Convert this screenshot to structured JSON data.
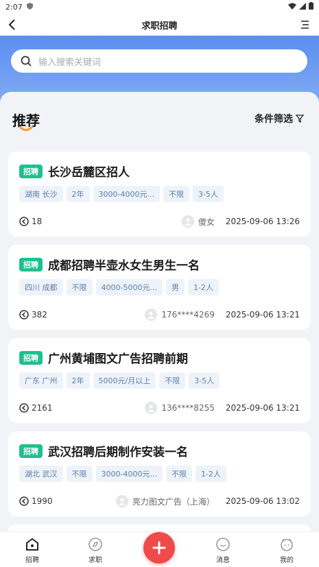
{
  "status_bar": {
    "time": "2:07"
  },
  "nav": {
    "title": "求职招聘"
  },
  "search": {
    "placeholder": "输入搜索关键词"
  },
  "section": {
    "title": "推荐",
    "filter_label": "条件筛选"
  },
  "colors": {
    "accent_blue": "#5b8ef0",
    "badge_green": "#1fbf8f",
    "fab_red": "#f04b4b",
    "smile_orange": "#f59b2b"
  },
  "cards": [
    {
      "badge": "招聘",
      "title": "长沙岳麓区招人",
      "tags": [
        "湖南 长沙",
        "2年",
        "3000-4000元...",
        "不限",
        "3-5人"
      ],
      "views": "18",
      "author": "傻女",
      "date": "2025-09-06 13:26"
    },
    {
      "badge": "招聘",
      "title": "成都招聘半壶水女生男生一名",
      "tags": [
        "四川 成都",
        "不限",
        "4000-5000元...",
        "男",
        "1-2人"
      ],
      "views": "382",
      "author": "176****4269",
      "date": "2025-09-06 13:21"
    },
    {
      "badge": "招聘",
      "title": "广州黄埔图文广告招聘前期",
      "tags": [
        "广东 广州",
        "2年",
        "5000元/月以上",
        "不限",
        "3-5人"
      ],
      "views": "2161",
      "author": "136****8255",
      "date": "2025-09-06 13:21"
    },
    {
      "badge": "招聘",
      "title": "武汉招聘后期制作安装一名",
      "tags": [
        "湖北 武汉",
        "不限",
        "3000-4000元...",
        "不限",
        "1-2人"
      ],
      "views": "1990",
      "author": "亮力图文广告（上海）",
      "date": "2025-09-06 13:02"
    }
  ],
  "tabbar": {
    "tabs": [
      {
        "label": "招聘",
        "icon": "home-icon"
      },
      {
        "label": "求职",
        "icon": "compass-icon"
      },
      {
        "label": "消息",
        "icon": "chat-icon"
      },
      {
        "label": "我的",
        "icon": "user-icon"
      }
    ],
    "fab_icon": "plus-icon"
  }
}
